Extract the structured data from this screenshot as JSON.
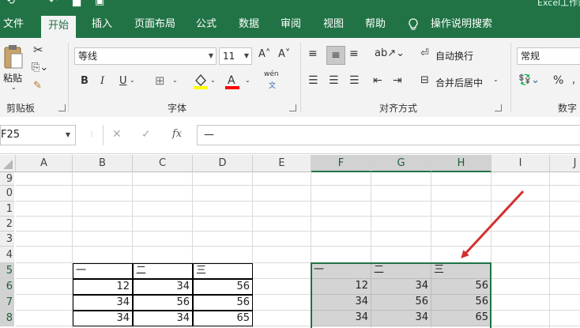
{
  "window": {
    "title": "Excel工作簿"
  },
  "menu": {
    "items": [
      "文件",
      "开始",
      "插入",
      "页面布局",
      "公式",
      "数据",
      "审阅",
      "视图",
      "帮助",
      "操作说明搜索"
    ],
    "active": "开始",
    "search_icon": "lightbulb-icon"
  },
  "ribbon": {
    "clipboard": {
      "paste": "粘贴",
      "group": "剪贴板"
    },
    "font": {
      "name": "等线",
      "size": "11",
      "grow": "A˄",
      "shrink": "A˅",
      "bold": "B",
      "italic": "I",
      "underline": "U",
      "phonetic": "wén",
      "phonetic_sub": "文",
      "group": "字体",
      "fill_color": "#ffff00",
      "font_color": "#ff0000"
    },
    "alignment": {
      "wrap": "自动换行",
      "merge": "合并后居中",
      "group": "对齐方式"
    },
    "number": {
      "format": "常规",
      "percent": "%",
      "group": "数字"
    }
  },
  "formula_bar": {
    "name_box": "F25",
    "cancel": "✕",
    "enter": "✓",
    "fx": "fx",
    "content": "—"
  },
  "grid": {
    "columns": [
      "A",
      "B",
      "C",
      "D",
      "E",
      "F",
      "G",
      "H",
      "I",
      "J"
    ],
    "rows": [
      "9",
      "0",
      "1",
      "2",
      "3",
      "4",
      "5",
      "6",
      "7",
      "8"
    ],
    "left_table": [
      [
        "一",
        "二",
        "三"
      ],
      [
        "12",
        "34",
        "56"
      ],
      [
        "34",
        "56",
        "56"
      ],
      [
        "34",
        "34",
        "65"
      ]
    ],
    "right_table": [
      [
        "一",
        "二",
        "三"
      ],
      [
        "12",
        "34",
        "56"
      ],
      [
        "34",
        "56",
        "56"
      ],
      [
        "34",
        "34",
        "65"
      ]
    ]
  },
  "colors": {
    "accent": "#217346",
    "selection_fill": "#d4d4d4",
    "arrow": "#d32f2f"
  }
}
